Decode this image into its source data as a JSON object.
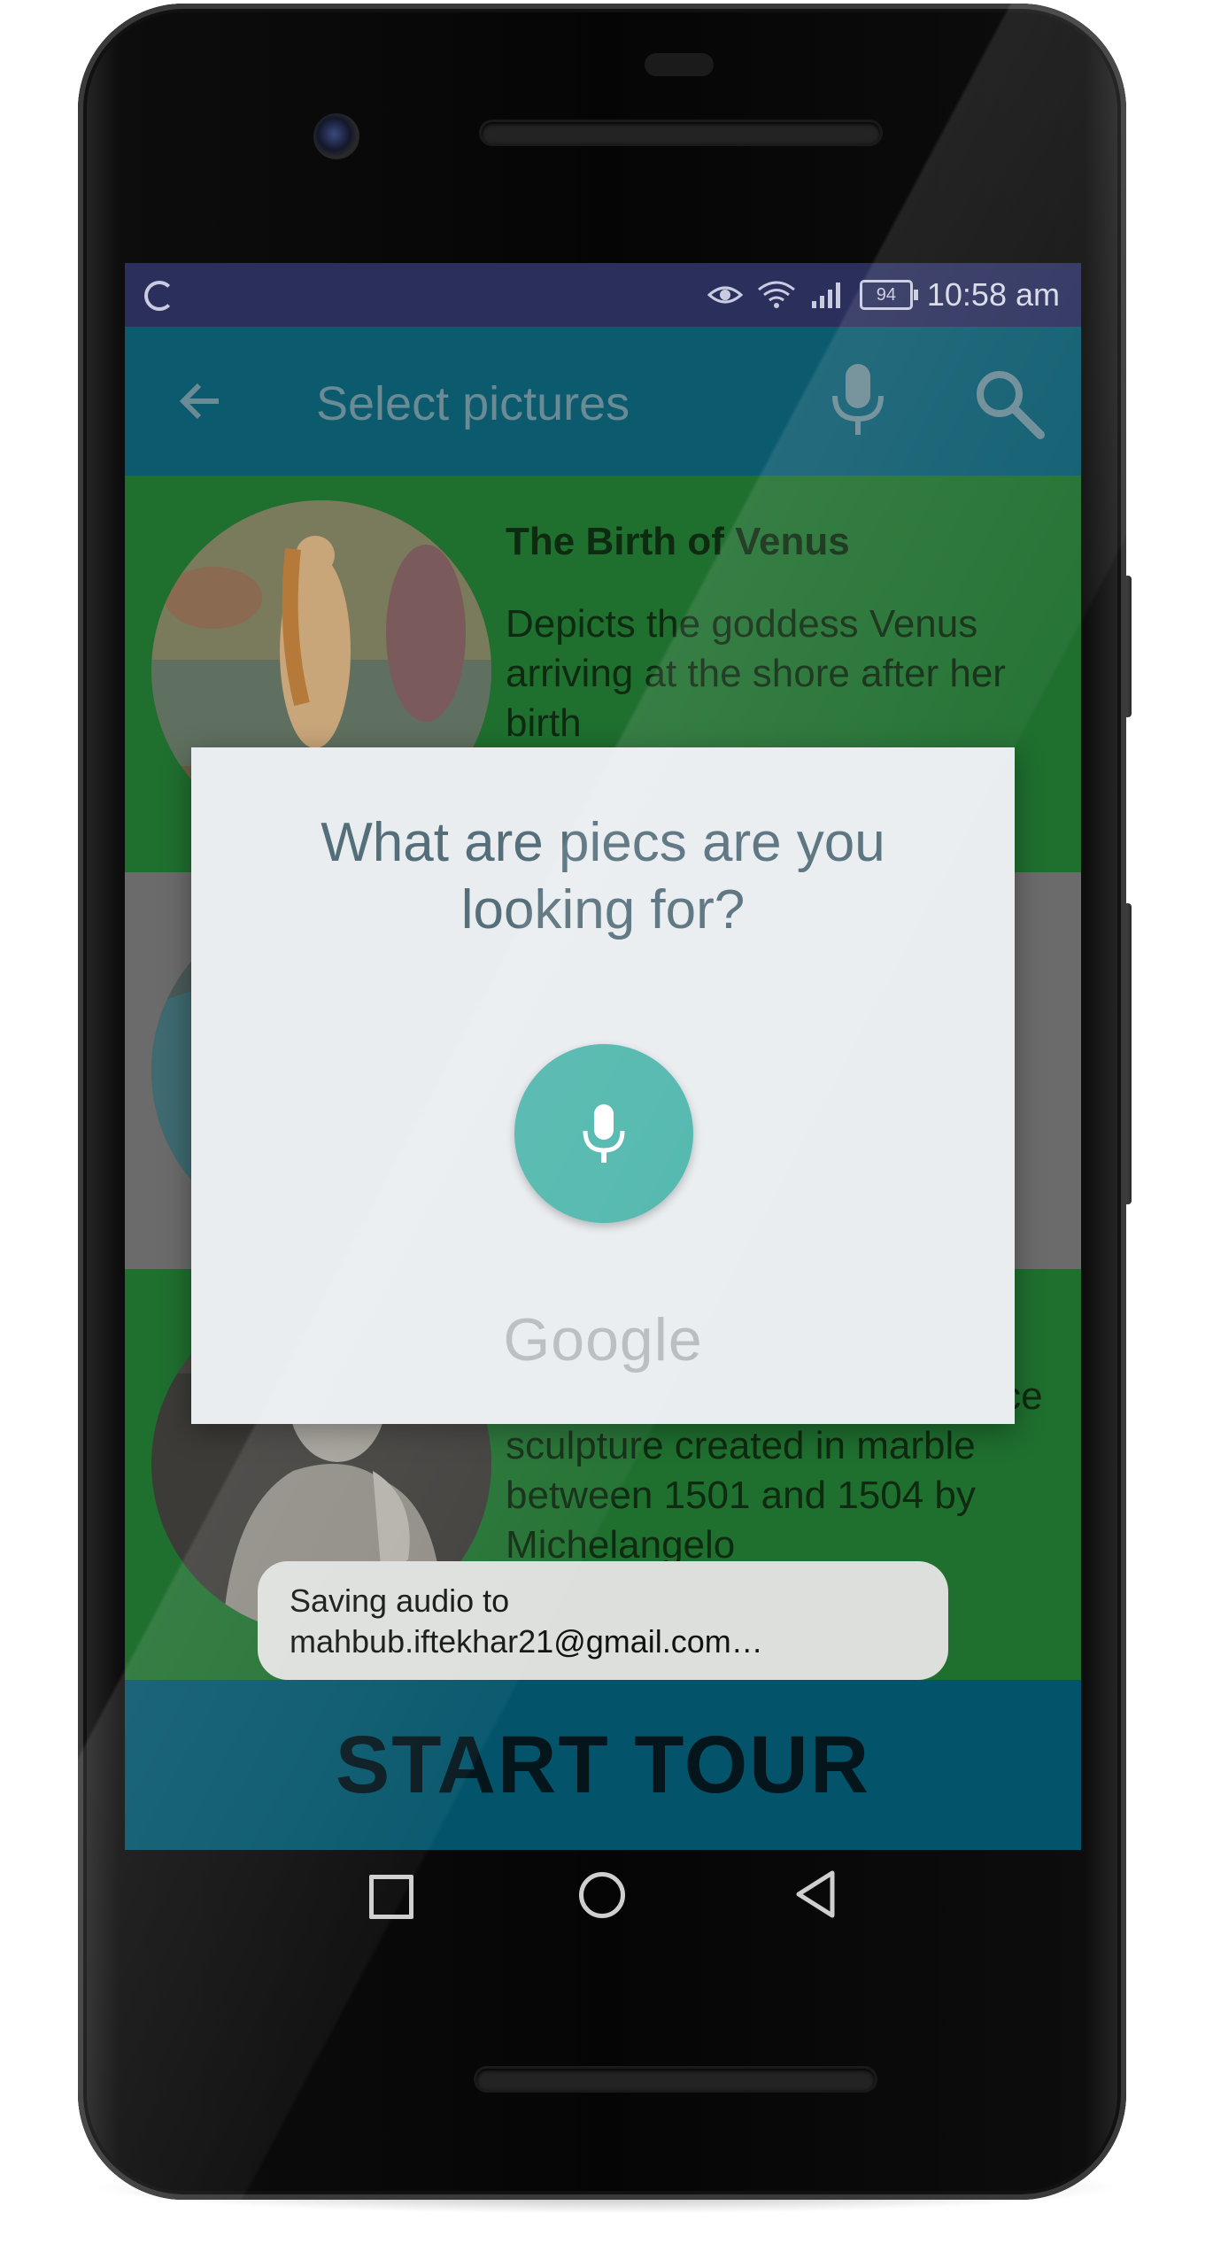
{
  "status_bar": {
    "battery": "94",
    "time": "10:58 am"
  },
  "app_bar": {
    "title": "Select pictures"
  },
  "list": {
    "items": [
      {
        "title": "The Birth of Venus",
        "description": "Depicts the goddess Venus arriving at the shore after her birth"
      },
      {
        "title": "",
        "description": ""
      },
      {
        "title": "",
        "description": "A masterpiece of Renais sance sculpture created in marble between 1501 and 1504 by Michelangelo"
      }
    ]
  },
  "start_tour_label": "START TOUR",
  "voice_dialog": {
    "prompt": "What are piecs are you looking for?",
    "brand": "Google"
  },
  "toast": {
    "line1": "Saving audio to",
    "line2": "mahbub.iftekhar21@gmail.com…"
  },
  "colors": {
    "status_bar": "#2a2f5c",
    "app_bar": "#0b5a6e",
    "list_item_bg": "#1f6f2f",
    "divider_gray": "#6b6b6b",
    "start_tour_bg": "#03546a",
    "dialog_bg": "#e9edf0",
    "mic_button": "#4db6ac",
    "toast_bg": "#dcdfdc"
  },
  "icons": {
    "status_loader": "loading-circle-icon",
    "eye": "eye-comfort-icon",
    "wifi": "wifi-icon",
    "signal": "cell-signal-icon",
    "battery": "battery-icon",
    "back": "arrow-back-icon",
    "mic": "microphone-icon",
    "search": "search-icon",
    "nav_recent": "square-recents-icon",
    "nav_home": "circle-home-icon",
    "nav_back": "triangle-back-icon"
  }
}
